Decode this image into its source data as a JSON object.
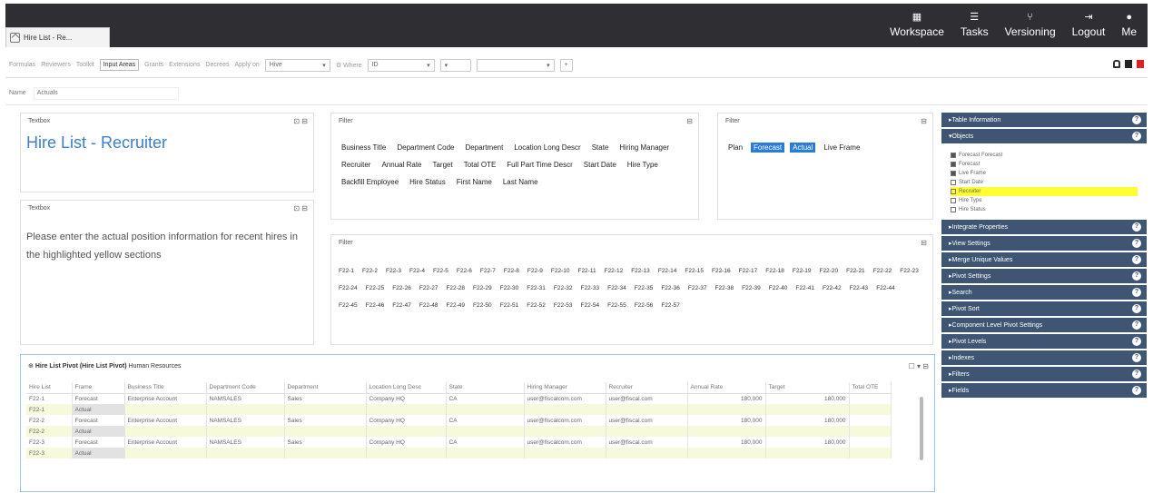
{
  "tab": {
    "label": "Hire List - Re..."
  },
  "nav": [
    {
      "label": "Workspace",
      "icon": "workspace-icon"
    },
    {
      "label": "Tasks",
      "icon": "tasks-icon"
    },
    {
      "label": "Versioning",
      "icon": "versioning-icon"
    },
    {
      "label": "Logout",
      "icon": "logout-icon"
    },
    {
      "label": "Me",
      "icon": "user-icon"
    }
  ],
  "toolbar": {
    "items": [
      "Formulas",
      "Reviewers",
      "Toolkit",
      "Input Areas",
      "Grants",
      "Extensions",
      "Decrees",
      "Apply on"
    ],
    "active": "Input Areas",
    "select1": "Hive",
    "where_label": "Where",
    "select2": "ID"
  },
  "namebar": {
    "label": "Name",
    "value": "Actuals"
  },
  "textbox1": {
    "title": "Textbox",
    "heading": "Hire List - Recruiter"
  },
  "textbox2": {
    "title": "Textbox",
    "text": "Please enter the actual position information for recent hires in the highlighted yellow sections"
  },
  "filter1": {
    "title": "Filter",
    "chips": [
      "Business Title",
      "Department Code",
      "Department",
      "Location Long Descr",
      "State",
      "Hiring Manager",
      "Recruiter",
      "Annual Rate",
      "Target",
      "Total OTE",
      "Full Part Time Descr",
      "Start Date",
      "Hire Type",
      "Backfill Employee",
      "Hire Status",
      "First Name",
      "Last Name"
    ]
  },
  "filter2": {
    "title": "Filter",
    "chips": [
      "Plan",
      "Forecast",
      "Actual",
      "Live Frame"
    ],
    "selected": [
      "Forecast",
      "Actual"
    ]
  },
  "filter3": {
    "title": "Filter",
    "chips": [
      "F22-1",
      "F22-2",
      "F22-3",
      "F22-4",
      "F22-5",
      "F22-6",
      "F22-7",
      "F22-8",
      "F22-9",
      "F22-10",
      "F22-11",
      "F22-12",
      "F22-13",
      "F22-14",
      "F22-15",
      "F22-16",
      "F22-17",
      "F22-18",
      "F22-19",
      "F22-20",
      "F22-21",
      "F22-22",
      "F22-23",
      "F22-24",
      "F22-25",
      "F22-26",
      "F22-27",
      "F22-28",
      "F22-29",
      "F22-30",
      "F22-31",
      "F22-32",
      "F22-33",
      "F22-34",
      "F22-35",
      "F22-36",
      "F22-37",
      "F22-38",
      "F22-39",
      "F22-40",
      "F22-41",
      "F22-42",
      "F22-43",
      "F22-44",
      "F22-45",
      "F22-46",
      "F22-47",
      "F22-48",
      "F22-49",
      "F22-50",
      "F22-51",
      "F22-52",
      "F22-53",
      "F22-54",
      "F22-55",
      "F22-56",
      "F22-57"
    ]
  },
  "sidebar": {
    "sections_top": [
      "Table Information",
      "Objects"
    ],
    "objects": [
      {
        "label": "Forecast Forecast",
        "checked": true
      },
      {
        "label": "Forecast",
        "checked": true
      },
      {
        "label": "Live Frame",
        "checked": true
      },
      {
        "label": "Start Date",
        "checked": false
      },
      {
        "label": "Recruiter",
        "checked": false,
        "highlight": true
      },
      {
        "label": "Hire Type",
        "checked": false
      },
      {
        "label": "Hire Status",
        "checked": false
      }
    ],
    "sections": [
      "Integrate Properties",
      "View Settings",
      "Merge Unique Values",
      "Pivot Settings",
      "Search",
      "Pivot Sort",
      "Component Level Pivot Settings",
      "Pivot Levels",
      "Indexes",
      "Filters",
      "Fields"
    ]
  },
  "grid": {
    "title_bold": "Hire List Pivot (Hire List Pivot)",
    "title_rest": "Human Resources",
    "columns": [
      "Hire List",
      "Frame",
      "Business Title",
      "Department Code",
      "Department",
      "Location Long Desc",
      "State",
      "Hiring Manager",
      "Recruiter",
      "Annual Rate",
      "Target",
      "Total OTE"
    ],
    "rows": [
      {
        "type": "forecast",
        "cells": [
          "F22-1",
          "Forecast",
          "Enterprise Account",
          "NAMSALES",
          "Sales",
          "Company HQ",
          "CA",
          "user@fiscalcom.com",
          "user@fiscal.com",
          "180,000",
          "180,000",
          ""
        ]
      },
      {
        "type": "actual",
        "cells": [
          "F22-1",
          "Actual",
          "",
          "",
          "",
          "",
          "",
          "",
          "",
          "",
          "",
          ""
        ]
      },
      {
        "type": "forecast",
        "cells": [
          "F22-2",
          "Forecast",
          "Enterprise Account",
          "NAMSALES",
          "Sales",
          "Company HQ",
          "CA",
          "user@fiscalcom.com",
          "user@fiscal.com",
          "180,000",
          "180,000",
          ""
        ]
      },
      {
        "type": "actual",
        "cells": [
          "F22-2",
          "Actual",
          "",
          "",
          "",
          "",
          "",
          "",
          "",
          "",
          "",
          ""
        ]
      },
      {
        "type": "forecast",
        "cells": [
          "F22-3",
          "Forecast",
          "Enterprise Account",
          "NAMSALES",
          "Sales",
          "Company HQ",
          "CA",
          "user@fiscalcom.com",
          "user@fiscal.com",
          "180,000",
          "180,000",
          ""
        ]
      },
      {
        "type": "actual",
        "cells": [
          "F22-3",
          "Actual",
          "",
          "",
          "",
          "",
          "",
          "",
          "",
          "",
          "",
          ""
        ]
      }
    ]
  }
}
